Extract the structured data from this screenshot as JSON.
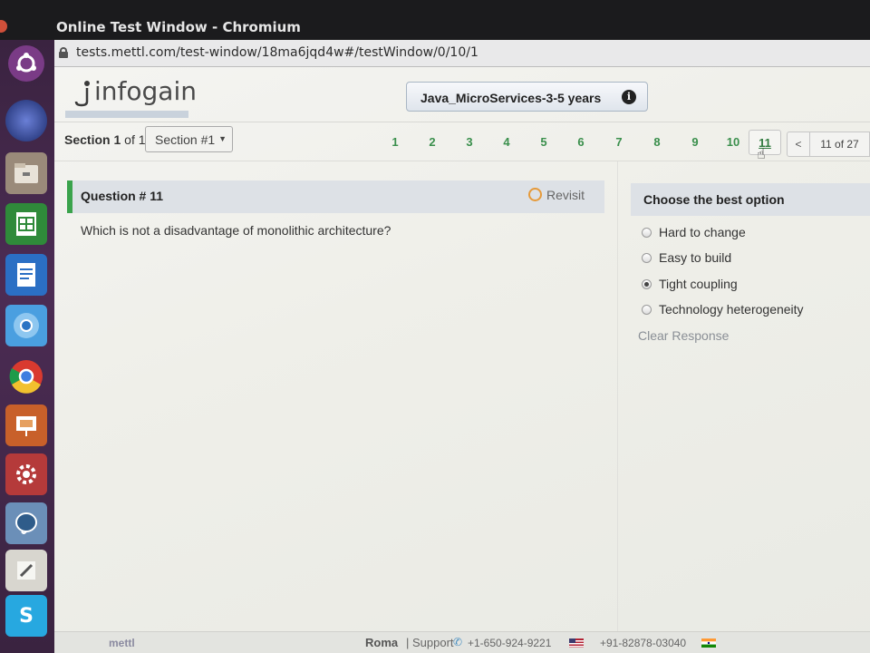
{
  "window": {
    "title": "Online Test Window - Chromium"
  },
  "browser": {
    "url": "tests.mettl.com/test-window/18ma6jqd4w#/testWindow/0/10/1"
  },
  "header": {
    "logo_text": "infogain",
    "test_name": "Java_MicroServices-3-5 years"
  },
  "section": {
    "label_prefix": "Section",
    "current": "1",
    "of_label": "of",
    "total": "1",
    "select_value": "Section #1"
  },
  "navigation": {
    "question_numbers": [
      "1",
      "2",
      "3",
      "4",
      "5",
      "6",
      "7",
      "8",
      "9",
      "10",
      "11"
    ],
    "current_question": "11",
    "prev_label": "<",
    "page_indicator": "11 of 27"
  },
  "question": {
    "title": "Question # 11",
    "revisit_label": "Revisit",
    "text": "Which is not a disadvantage of monolithic architecture?"
  },
  "options": {
    "header": "Choose the best option",
    "items": [
      {
        "label": "Hard to change",
        "selected": false
      },
      {
        "label": "Easy to build",
        "selected": false
      },
      {
        "label": "Tight coupling",
        "selected": true
      },
      {
        "label": "Technology heterogeneity",
        "selected": false
      }
    ],
    "clear_label": "Clear Response"
  },
  "footer": {
    "brand": "mettl",
    "city": "Roma",
    "support_label": "| Support",
    "phone_us": "+1-650-924-9221",
    "phone_in": "+91-82878-03040"
  },
  "colors": {
    "accent_green": "#3aa34c",
    "question_number_green": "#3a8f4c",
    "header_panel": "#dde1e6",
    "launcher_purple": "#4c2c54"
  },
  "launcher_icons": [
    "ubuntu-dash-icon",
    "browser-icon",
    "files-icon",
    "spreadsheet-icon",
    "document-icon",
    "chromium-icon",
    "chrome-icon",
    "presentation-icon",
    "settings-icon",
    "database-icon",
    "text-editor-icon",
    "skype-icon"
  ]
}
